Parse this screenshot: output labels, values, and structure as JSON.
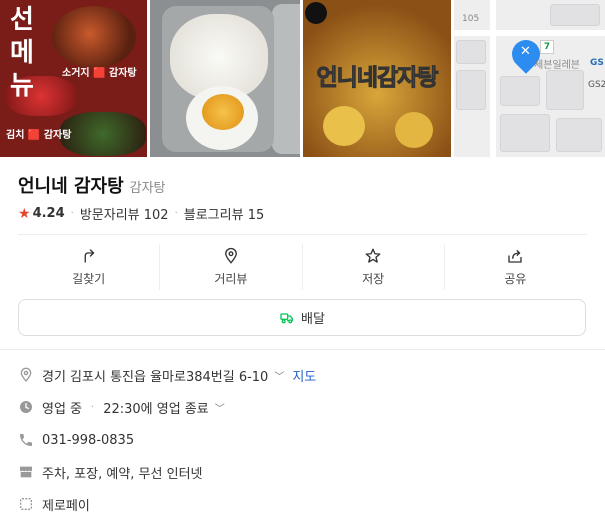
{
  "photos": {
    "photo1_text": "선\n메\n뉴",
    "photo1_caption_top": "소거지 🟥 감자탕",
    "photo1_caption_bottom": "김치 🟥 감자탕",
    "photo3_overlay": "언니네감자탕",
    "map": {
      "number_label": "105",
      "store_label": "세븐일레븐",
      "gs_label_1": "GS",
      "gs_label_2": "GS2"
    }
  },
  "place": {
    "name": "언니네 감자탕",
    "category": "감자탕",
    "rating": "4.24",
    "visitor_reviews": "방문자리뷰 102",
    "blog_reviews": "블로그리뷰 15"
  },
  "actions": [
    {
      "label": "길찾기",
      "icon": "directions-icon"
    },
    {
      "label": "거리뷰",
      "icon": "pin-icon"
    },
    {
      "label": "저장",
      "icon": "star-icon"
    },
    {
      "label": "공유",
      "icon": "share-icon"
    }
  ],
  "delivery": {
    "label": "배달",
    "color": "#03c75a"
  },
  "info": {
    "address": "경기 김포시 통진읍 율마로384번길 6-10",
    "map_link": "지도",
    "status": "영업 중",
    "hours": "22:30에 영업 종료",
    "phone": "031-998-0835",
    "amenities": "주차, 포장, 예약, 무선 인터넷",
    "payment": "제로페이"
  },
  "colors": {
    "accent_link": "#2462c8",
    "rating_star": "#e5482d"
  }
}
